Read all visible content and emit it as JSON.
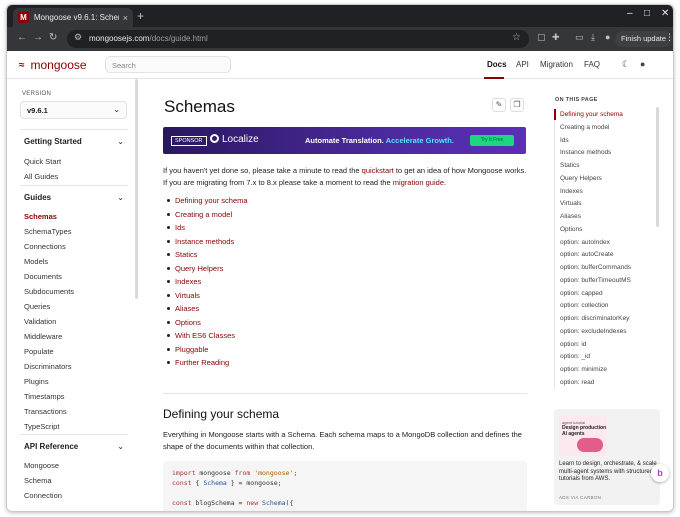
{
  "browser": {
    "tab_title": "Mongoose v9.6.1: Schem",
    "tab_close": "×",
    "new_tab": "+",
    "url_host": "mongoosejs.com",
    "url_path": "/docs/guide.html",
    "finish_update": "Finish update",
    "window_controls": [
      "–",
      "□",
      "✕"
    ]
  },
  "site": {
    "logo": "mongoose",
    "search_placeholder": "Search",
    "nav": [
      "Docs",
      "API",
      "Migration",
      "FAQ"
    ]
  },
  "left_sidebar": {
    "version_label": "VERSION",
    "version": "v9.6.1",
    "sections": [
      {
        "title": "Getting Started",
        "items": [
          "Quick Start",
          "All Guides"
        ]
      },
      {
        "title": "Guides",
        "items": [
          "Schemas",
          "SchemaTypes",
          "Connections",
          "Models",
          "Documents",
          "Subdocuments",
          "Queries",
          "Validation",
          "Middleware",
          "Populate",
          "Discriminators",
          "Plugins",
          "Timestamps",
          "Transactions",
          "TypeScript"
        ]
      },
      {
        "title": "API Reference",
        "items": [
          "Mongoose",
          "Schema",
          "Connection"
        ]
      }
    ],
    "active_item": "Schemas"
  },
  "main": {
    "title": "Schemas",
    "banner": {
      "sponsor": "SPONSOR",
      "brand": "Localize",
      "slogan_a": "Automate Translation.",
      "slogan_b": "Accelerate Growth.",
      "cta": "Try It Free"
    },
    "intro_1": "If you haven't yet done so, please take a minute to read the ",
    "intro_link_1": "quickstart",
    "intro_2": " to get an idea of how Mongoose works. If you are migrating from 7.x to 8.x please take a moment to read the ",
    "intro_link_2": "migration guide",
    "intro_3": ".",
    "toc": [
      "Defining your schema",
      "Creating a model",
      "Ids",
      "Instance methods",
      "Statics",
      "Query Helpers",
      "Indexes",
      "Virtuals",
      "Aliases",
      "Options",
      "With ES6 Classes",
      "Pluggable",
      "Further Reading"
    ],
    "section_title": "Defining your schema",
    "section_text": "Everything in Mongoose starts with a Schema. Each schema maps to a MongoDB collection and defines the shape of the documents within that collection.",
    "code": {
      "l1_kw": "import",
      "l1_a": " mongoose ",
      "l1_kw2": "from",
      "l1_str": " 'mongoose'",
      "l1_b": ";",
      "l2_kw": "const",
      "l2_a": " { ",
      "l2_fn": "Schema",
      "l2_b": " } = mongoose;",
      "l3_kw": "const",
      "l3_a": " blogSchema = ",
      "l3_kw2": "new",
      "l3_fn": " Schema",
      "l3_b": "({"
    }
  },
  "right_sidebar": {
    "heading": "ON THIS PAGE",
    "items": [
      "Defining your schema",
      "Creating a model",
      "Ids",
      "Instance methods",
      "Statics",
      "Query Helpers",
      "Indexes",
      "Virtuals",
      "Aliases",
      "Options",
      "option: autoIndex",
      "option: autoCreate",
      "option: bufferCommands",
      "option: bufferTimeoutMS",
      "option: capped",
      "option: collection",
      "option: discriminatorKey",
      "option: excludeIndexes",
      "option: id",
      "option: _id",
      "option: minimize",
      "option: read"
    ],
    "ad": {
      "img_small": "agent tutorial",
      "img_title": "Design production AI agents",
      "text": "Learn to design, orchestrate, & scale multi-agent systems with structured tutorials from AWS.",
      "via": "ADS VIA CARBON"
    }
  },
  "colors": {
    "brand": "#880000",
    "chrome_dark": "#202124",
    "banner": "#4a2a9c",
    "cta": "#1ed67f"
  }
}
